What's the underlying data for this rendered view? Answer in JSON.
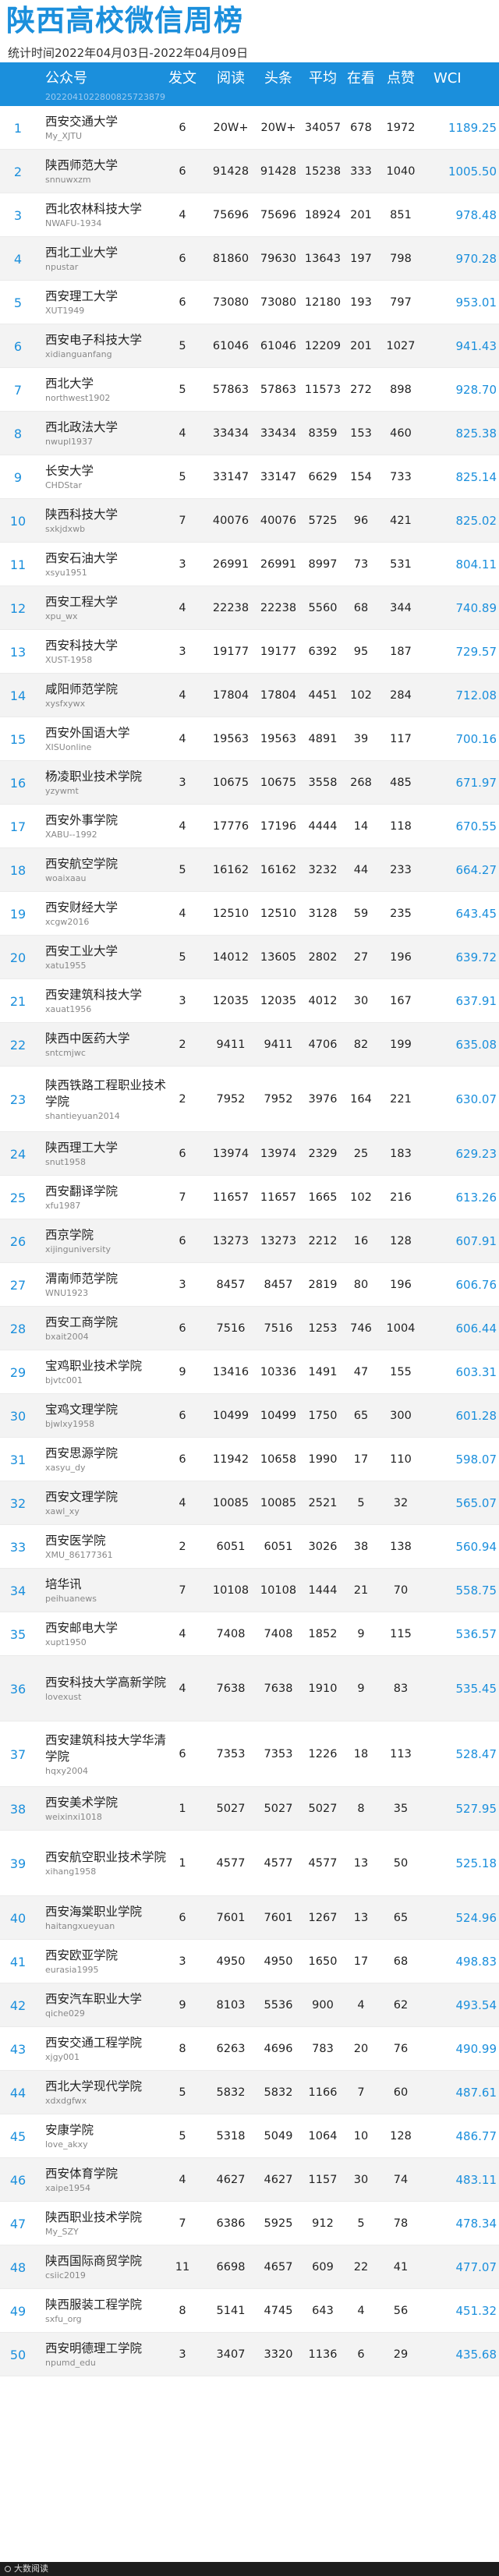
{
  "title": "陕西高校微信周榜",
  "stat_period": "统计时间2022年04月03日-2022年04月09日",
  "header": {
    "name": "公众号",
    "fa": "发文",
    "yd": "阅读",
    "tt": "头条",
    "pj": "平均",
    "zk": "在看",
    "dz": "点赞",
    "wci": "WCI",
    "sub": "2022041022800825723879"
  },
  "rows": [
    {
      "rank": "1",
      "name": "西安交通大学",
      "account": "My_XJTU",
      "fa": "6",
      "yd": "20W+",
      "tt": "20W+",
      "pj": "34057",
      "zk": "678",
      "dz": "1972",
      "wci": "1189.25"
    },
    {
      "rank": "2",
      "name": "陕西师范大学",
      "account": "snnuwxzm",
      "fa": "6",
      "yd": "91428",
      "tt": "91428",
      "pj": "15238",
      "zk": "333",
      "dz": "1040",
      "wci": "1005.50"
    },
    {
      "rank": "3",
      "name": "西北农林科技大学",
      "account": "NWAFU-1934",
      "fa": "4",
      "yd": "75696",
      "tt": "75696",
      "pj": "18924",
      "zk": "201",
      "dz": "851",
      "wci": "978.48"
    },
    {
      "rank": "4",
      "name": "西北工业大学",
      "account": "npustar",
      "fa": "6",
      "yd": "81860",
      "tt": "79630",
      "pj": "13643",
      "zk": "197",
      "dz": "798",
      "wci": "970.28"
    },
    {
      "rank": "5",
      "name": "西安理工大学",
      "account": "XUT1949",
      "fa": "6",
      "yd": "73080",
      "tt": "73080",
      "pj": "12180",
      "zk": "193",
      "dz": "797",
      "wci": "953.01"
    },
    {
      "rank": "6",
      "name": "西安电子科技大学",
      "account": "xidianguanfang",
      "fa": "5",
      "yd": "61046",
      "tt": "61046",
      "pj": "12209",
      "zk": "201",
      "dz": "1027",
      "wci": "941.43"
    },
    {
      "rank": "7",
      "name": "西北大学",
      "account": "northwest1902",
      "fa": "5",
      "yd": "57863",
      "tt": "57863",
      "pj": "11573",
      "zk": "272",
      "dz": "898",
      "wci": "928.70"
    },
    {
      "rank": "8",
      "name": "西北政法大学",
      "account": "nwupl1937",
      "fa": "4",
      "yd": "33434",
      "tt": "33434",
      "pj": "8359",
      "zk": "153",
      "dz": "460",
      "wci": "825.38"
    },
    {
      "rank": "9",
      "name": "长安大学",
      "account": "CHDStar",
      "fa": "5",
      "yd": "33147",
      "tt": "33147",
      "pj": "6629",
      "zk": "154",
      "dz": "733",
      "wci": "825.14"
    },
    {
      "rank": "10",
      "name": "陕西科技大学",
      "account": "sxkjdxwb",
      "fa": "7",
      "yd": "40076",
      "tt": "40076",
      "pj": "5725",
      "zk": "96",
      "dz": "421",
      "wci": "825.02"
    },
    {
      "rank": "11",
      "name": "西安石油大学",
      "account": "xsyu1951",
      "fa": "3",
      "yd": "26991",
      "tt": "26991",
      "pj": "8997",
      "zk": "73",
      "dz": "531",
      "wci": "804.11"
    },
    {
      "rank": "12",
      "name": "西安工程大学",
      "account": "xpu_wx",
      "fa": "4",
      "yd": "22238",
      "tt": "22238",
      "pj": "5560",
      "zk": "68",
      "dz": "344",
      "wci": "740.89"
    },
    {
      "rank": "13",
      "name": "西安科技大学",
      "account": "XUST-1958",
      "fa": "3",
      "yd": "19177",
      "tt": "19177",
      "pj": "6392",
      "zk": "95",
      "dz": "187",
      "wci": "729.57"
    },
    {
      "rank": "14",
      "name": "咸阳师范学院",
      "account": "xysfxywx",
      "fa": "4",
      "yd": "17804",
      "tt": "17804",
      "pj": "4451",
      "zk": "102",
      "dz": "284",
      "wci": "712.08"
    },
    {
      "rank": "15",
      "name": "西安外国语大学",
      "account": "XISUonline",
      "fa": "4",
      "yd": "19563",
      "tt": "19563",
      "pj": "4891",
      "zk": "39",
      "dz": "117",
      "wci": "700.16"
    },
    {
      "rank": "16",
      "name": "杨凌职业技术学院",
      "account": "yzywmt",
      "fa": "3",
      "yd": "10675",
      "tt": "10675",
      "pj": "3558",
      "zk": "268",
      "dz": "485",
      "wci": "671.97"
    },
    {
      "rank": "17",
      "name": "西安外事学院",
      "account": "XABU--1992",
      "fa": "4",
      "yd": "17776",
      "tt": "17196",
      "pj": "4444",
      "zk": "14",
      "dz": "118",
      "wci": "670.55"
    },
    {
      "rank": "18",
      "name": "西安航空学院",
      "account": "woaixaau",
      "fa": "5",
      "yd": "16162",
      "tt": "16162",
      "pj": "3232",
      "zk": "44",
      "dz": "233",
      "wci": "664.27"
    },
    {
      "rank": "19",
      "name": "西安财经大学",
      "account": "xcgw2016",
      "fa": "4",
      "yd": "12510",
      "tt": "12510",
      "pj": "3128",
      "zk": "59",
      "dz": "235",
      "wci": "643.45"
    },
    {
      "rank": "20",
      "name": "西安工业大学",
      "account": "xatu1955",
      "fa": "5",
      "yd": "14012",
      "tt": "13605",
      "pj": "2802",
      "zk": "27",
      "dz": "196",
      "wci": "639.72"
    },
    {
      "rank": "21",
      "name": "西安建筑科技大学",
      "account": "xauat1956",
      "fa": "3",
      "yd": "12035",
      "tt": "12035",
      "pj": "4012",
      "zk": "30",
      "dz": "167",
      "wci": "637.91"
    },
    {
      "rank": "22",
      "name": "陕西中医药大学",
      "account": "sntcmjwc",
      "fa": "2",
      "yd": "9411",
      "tt": "9411",
      "pj": "4706",
      "zk": "82",
      "dz": "199",
      "wci": "635.08"
    },
    {
      "rank": "23",
      "name": "陕西铁路工程职业技术学院",
      "account": "shantieyuan2014",
      "fa": "2",
      "yd": "7952",
      "tt": "7952",
      "pj": "3976",
      "zk": "164",
      "dz": "221",
      "wci": "630.07",
      "tall": true
    },
    {
      "rank": "24",
      "name": "陕西理工大学",
      "account": "snut1958",
      "fa": "6",
      "yd": "13974",
      "tt": "13974",
      "pj": "2329",
      "zk": "25",
      "dz": "183",
      "wci": "629.23"
    },
    {
      "rank": "25",
      "name": "西安翻译学院",
      "account": "xfu1987",
      "fa": "7",
      "yd": "11657",
      "tt": "11657",
      "pj": "1665",
      "zk": "102",
      "dz": "216",
      "wci": "613.26"
    },
    {
      "rank": "26",
      "name": "西京学院",
      "account": "xijinguniversity",
      "fa": "6",
      "yd": "13273",
      "tt": "13273",
      "pj": "2212",
      "zk": "16",
      "dz": "128",
      "wci": "607.91"
    },
    {
      "rank": "27",
      "name": "渭南师范学院",
      "account": "WNU1923",
      "fa": "3",
      "yd": "8457",
      "tt": "8457",
      "pj": "2819",
      "zk": "80",
      "dz": "196",
      "wci": "606.76"
    },
    {
      "rank": "28",
      "name": "西安工商学院",
      "account": "bxait2004",
      "fa": "6",
      "yd": "7516",
      "tt": "7516",
      "pj": "1253",
      "zk": "746",
      "dz": "1004",
      "wci": "606.44"
    },
    {
      "rank": "29",
      "name": "宝鸡职业技术学院",
      "account": "bjvtc001",
      "fa": "9",
      "yd": "13416",
      "tt": "10336",
      "pj": "1491",
      "zk": "47",
      "dz": "155",
      "wci": "603.31"
    },
    {
      "rank": "30",
      "name": "宝鸡文理学院",
      "account": "bjwlxy1958",
      "fa": "6",
      "yd": "10499",
      "tt": "10499",
      "pj": "1750",
      "zk": "65",
      "dz": "300",
      "wci": "601.28"
    },
    {
      "rank": "31",
      "name": "西安思源学院",
      "account": "xasyu_dy",
      "fa": "6",
      "yd": "11942",
      "tt": "10658",
      "pj": "1990",
      "zk": "17",
      "dz": "110",
      "wci": "598.07"
    },
    {
      "rank": "32",
      "name": "西安文理学院",
      "account": "xawl_xy",
      "fa": "4",
      "yd": "10085",
      "tt": "10085",
      "pj": "2521",
      "zk": "5",
      "dz": "32",
      "wci": "565.07"
    },
    {
      "rank": "33",
      "name": "西安医学院",
      "account": "XMU_86177361",
      "fa": "2",
      "yd": "6051",
      "tt": "6051",
      "pj": "3026",
      "zk": "38",
      "dz": "138",
      "wci": "560.94"
    },
    {
      "rank": "34",
      "name": "培华讯",
      "account": "peihuanews",
      "fa": "7",
      "yd": "10108",
      "tt": "10108",
      "pj": "1444",
      "zk": "21",
      "dz": "70",
      "wci": "558.75"
    },
    {
      "rank": "35",
      "name": "西安邮电大学",
      "account": "xupt1950",
      "fa": "4",
      "yd": "7408",
      "tt": "7408",
      "pj": "1852",
      "zk": "9",
      "dz": "115",
      "wci": "536.57"
    },
    {
      "rank": "36",
      "name": "西安科技大学高新学院",
      "account": "lovexust",
      "fa": "4",
      "yd": "7638",
      "tt": "7638",
      "pj": "1910",
      "zk": "9",
      "dz": "83",
      "wci": "535.45",
      "tall": true
    },
    {
      "rank": "37",
      "name": "西安建筑科技大学华清学院",
      "account": "hqxy2004",
      "fa": "6",
      "yd": "7353",
      "tt": "7353",
      "pj": "1226",
      "zk": "18",
      "dz": "113",
      "wci": "528.47",
      "tall": true
    },
    {
      "rank": "38",
      "name": "西安美术学院",
      "account": "weixinxi1018",
      "fa": "1",
      "yd": "5027",
      "tt": "5027",
      "pj": "5027",
      "zk": "8",
      "dz": "35",
      "wci": "527.95"
    },
    {
      "rank": "39",
      "name": "西安航空职业技术学院",
      "account": "xihang1958",
      "fa": "1",
      "yd": "4577",
      "tt": "4577",
      "pj": "4577",
      "zk": "13",
      "dz": "50",
      "wci": "525.18",
      "tall": true
    },
    {
      "rank": "40",
      "name": "西安海棠职业学院",
      "account": "haitangxueyuan",
      "fa": "6",
      "yd": "7601",
      "tt": "7601",
      "pj": "1267",
      "zk": "13",
      "dz": "65",
      "wci": "524.96"
    },
    {
      "rank": "41",
      "name": "西安欧亚学院",
      "account": "eurasia1995",
      "fa": "3",
      "yd": "4950",
      "tt": "4950",
      "pj": "1650",
      "zk": "17",
      "dz": "68",
      "wci": "498.83"
    },
    {
      "rank": "42",
      "name": "西安汽车职业大学",
      "account": "qiche029",
      "fa": "9",
      "yd": "8103",
      "tt": "5536",
      "pj": "900",
      "zk": "4",
      "dz": "62",
      "wci": "493.54"
    },
    {
      "rank": "43",
      "name": "西安交通工程学院",
      "account": "xjgy001",
      "fa": "8",
      "yd": "6263",
      "tt": "4696",
      "pj": "783",
      "zk": "20",
      "dz": "76",
      "wci": "490.99"
    },
    {
      "rank": "44",
      "name": "西北大学现代学院",
      "account": "xdxdgfwx",
      "fa": "5",
      "yd": "5832",
      "tt": "5832",
      "pj": "1166",
      "zk": "7",
      "dz": "60",
      "wci": "487.61"
    },
    {
      "rank": "45",
      "name": "安康学院",
      "account": "love_akxy",
      "fa": "5",
      "yd": "5318",
      "tt": "5049",
      "pj": "1064",
      "zk": "10",
      "dz": "128",
      "wci": "486.77"
    },
    {
      "rank": "46",
      "name": "西安体育学院",
      "account": "xaipe1954",
      "fa": "4",
      "yd": "4627",
      "tt": "4627",
      "pj": "1157",
      "zk": "30",
      "dz": "74",
      "wci": "483.11"
    },
    {
      "rank": "47",
      "name": "陕西职业技术学院",
      "account": "My_SZY",
      "fa": "7",
      "yd": "6386",
      "tt": "5925",
      "pj": "912",
      "zk": "5",
      "dz": "78",
      "wci": "478.34"
    },
    {
      "rank": "48",
      "name": "陕西国际商贸学院",
      "account": "csiic2019",
      "fa": "11",
      "yd": "6698",
      "tt": "4657",
      "pj": "609",
      "zk": "22",
      "dz": "41",
      "wci": "477.07"
    },
    {
      "rank": "49",
      "name": "陕西服装工程学院",
      "account": "sxfu_org",
      "fa": "8",
      "yd": "5141",
      "tt": "4745",
      "pj": "643",
      "zk": "4",
      "dz": "56",
      "wci": "451.32"
    },
    {
      "rank": "50",
      "name": "西安明德理工学院",
      "account": "npumd_edu",
      "fa": "3",
      "yd": "3407",
      "tt": "3320",
      "pj": "1136",
      "zk": "6",
      "dz": "29",
      "wci": "435.68"
    }
  ],
  "footer": {
    "brand": "大数阅读"
  },
  "colors": {
    "accent": "#1b8fdc",
    "alt_row": "#f3f3f3"
  }
}
